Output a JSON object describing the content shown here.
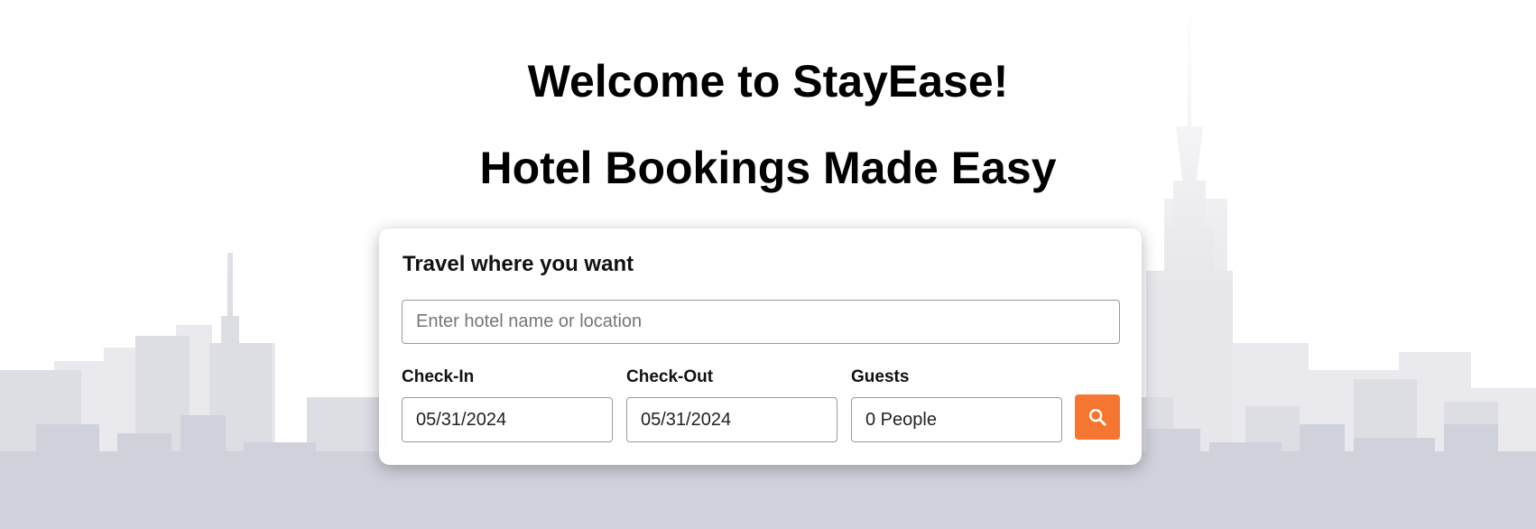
{
  "hero": {
    "welcome": "Welcome to StayEase!",
    "tagline": "Hotel Bookings Made Easy"
  },
  "search": {
    "card_title": "Travel where you want",
    "location_placeholder": "Enter hotel name or location",
    "location_value": "",
    "checkin_label": "Check-In",
    "checkin_value": "05/31/2024",
    "checkout_label": "Check-Out",
    "checkout_value": "05/31/2024",
    "guests_label": "Guests",
    "guests_value": "0 People",
    "search_icon": "search-icon"
  },
  "colors": {
    "accent": "#f47630",
    "background_skyline": "#c9cbd6"
  }
}
